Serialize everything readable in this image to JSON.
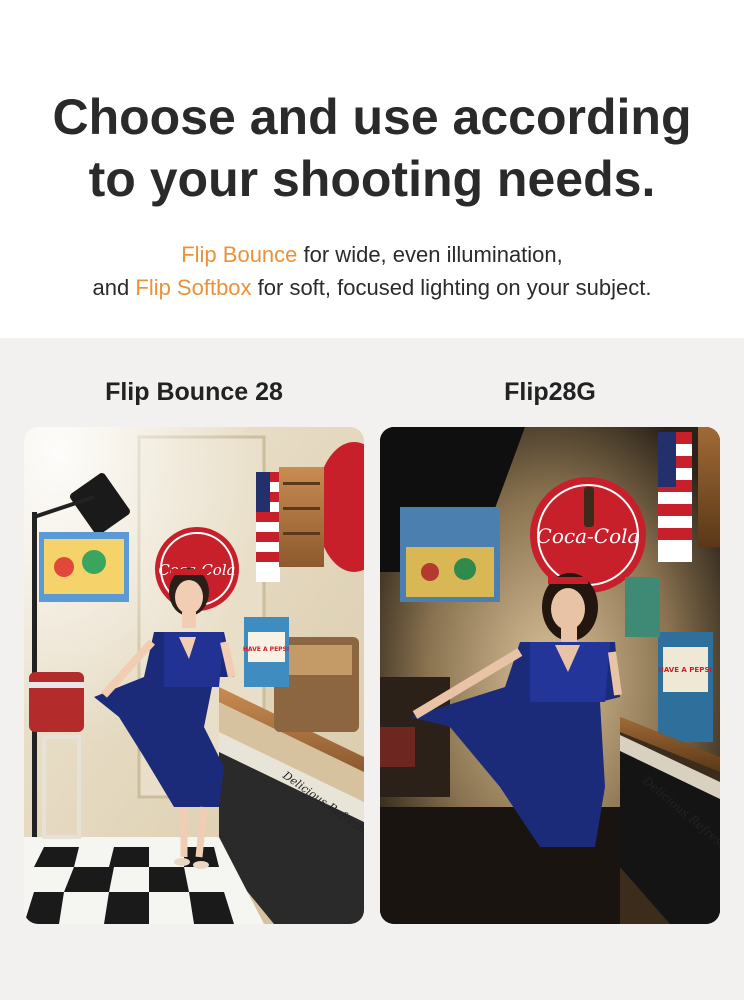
{
  "hero": {
    "headline_line1": "Choose and use according",
    "headline_line2": "to your shooting needs.",
    "sub_line1_accent": "Flip Bounce",
    "sub_line1_rest": " for wide, even illumination,",
    "sub_line2_prefix": "and ",
    "sub_line2_accent": "Flip Softbox",
    "sub_line2_rest": " for soft, focused lighting on your subject."
  },
  "compare": {
    "left_title": "Flip Bounce 28",
    "right_title": "Flip28G",
    "left_sign_text": "Coca-Cola",
    "right_sign_text": "Coca-Cola",
    "left_shelf_text": "Delicious Refreshing",
    "right_shelf_text": "Delicious Refreshi",
    "left_box_text": "HAVE A PEPSI",
    "right_box_text": "HAVE A PEPSI"
  },
  "colors": {
    "accent": "#e8923a",
    "compare_bg": "#f2f1f0",
    "dress": "#1c2a7a",
    "sign_red": "#c8202a"
  }
}
